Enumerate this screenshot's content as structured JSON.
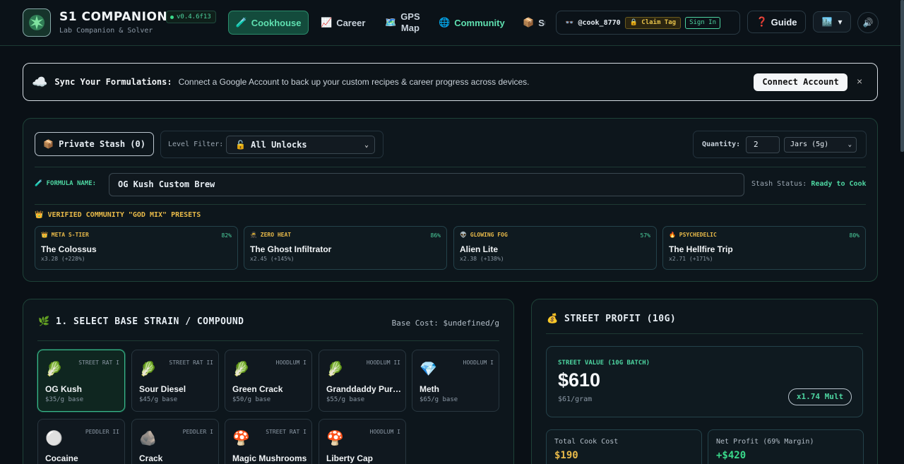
{
  "app": {
    "title": "S1 COMPANION",
    "version": "v0.4.6f13",
    "subtitle": "Lab Companion & Solver"
  },
  "nav": {
    "cookhouse": "Cookhouse",
    "career": "Career",
    "gps_line1": "GPS",
    "gps_line2": "Map",
    "community": "Community",
    "su": "Su"
  },
  "user": {
    "glasses_icon": "👓",
    "handle": "@cook_8770",
    "claim": "🔒 Claim Tag",
    "signin": "Sign In"
  },
  "guide": {
    "label": "Guide",
    "icon": "❓"
  },
  "city": {
    "icon": "🏙️",
    "chevron": "▾"
  },
  "sound": {
    "icon": "🔊"
  },
  "sync": {
    "icon": "☁️",
    "lead": "Sync Your Formulations:",
    "message": "Connect a Google Account to back up your custom recipes & career progress across devices.",
    "button": "Connect Account",
    "close": "×"
  },
  "formula": {
    "stash_button": "📦 Private Stash (0)",
    "level_label": "Level Filter:",
    "level_value": "🔓 All Unlocks",
    "quantity_label": "Quantity:",
    "quantity_value": "2",
    "unit_value": "Jars (5g)",
    "name_label": "🧪 FORMULA NAME:",
    "name_value": "OG Kush Custom Brew",
    "stash_status_label": "Stash Status:",
    "stash_status_value": "Ready to Cook",
    "presets_title": "👑 VERIFIED COMMUNITY \"GOD MIX\" PRESETS"
  },
  "presets": [
    {
      "tag": "👑 META S-TIER",
      "pct": "82%",
      "name": "The Colossus",
      "mult": "x3.28 (+228%)"
    },
    {
      "tag": "🥷 ZERO HEAT",
      "pct": "86%",
      "name": "The Ghost Infiltrator",
      "mult": "x2.45 (+145%)"
    },
    {
      "tag": "👽 GLOWING FOG",
      "pct": "57%",
      "name": "Alien Lite",
      "mult": "x2.38 (+138%)"
    },
    {
      "tag": "🔥 PSYCHEDELIC",
      "pct": "80%",
      "name": "The Hellfire Trip",
      "mult": "x2.71 (+171%)"
    }
  ],
  "strain_section": {
    "icon": "🌿",
    "title": "1. SELECT BASE STRAIN / COMPOUND",
    "base_cost": "Base Cost: $undefined/g"
  },
  "strains": [
    {
      "icon": "🥬",
      "tier": "STREET RAT I",
      "name": "OG Kush",
      "price": "$35/g base"
    },
    {
      "icon": "🥬",
      "tier": "STREET RAT II",
      "name": "Sour Diesel",
      "price": "$45/g base"
    },
    {
      "icon": "🥬",
      "tier": "HOODLUM I",
      "name": "Green Crack",
      "price": "$50/g base"
    },
    {
      "icon": "🥬",
      "tier": "HOODLUM II",
      "name": "Granddaddy Purple",
      "price": "$55/g base"
    },
    {
      "icon": "💎",
      "tier": "HOODLUM I",
      "name": "Meth",
      "price": "$65/g base"
    },
    {
      "icon": "⚪",
      "tier": "PEDDLER II",
      "name": "Cocaine",
      "price": ""
    },
    {
      "icon": "🪨",
      "tier": "PEDDLER I",
      "name": "Crack",
      "price": ""
    },
    {
      "icon": "🍄",
      "tier": "STREET RAT I",
      "name": "Magic Mushrooms",
      "price": ""
    },
    {
      "icon": "🍄",
      "tier": "HOODLUM I",
      "name": "Liberty Cap",
      "price": ""
    }
  ],
  "profit": {
    "icon": "💰",
    "title": "STREET PROFIT (10G)",
    "value_label": "STREET VALUE (10G BATCH)",
    "value": "$610",
    "per_gram": "$61/gram",
    "mult": "x1.74 Mult",
    "cost_label": "Total Cook Cost",
    "cost_value": "$190",
    "net_label": "Net Profit (69% Margin)",
    "net_value": "+$420"
  },
  "colors": {
    "accent": "#4dd4a0",
    "gold": "#e7b949",
    "cost": "#e7b949",
    "net": "#39d98a"
  }
}
